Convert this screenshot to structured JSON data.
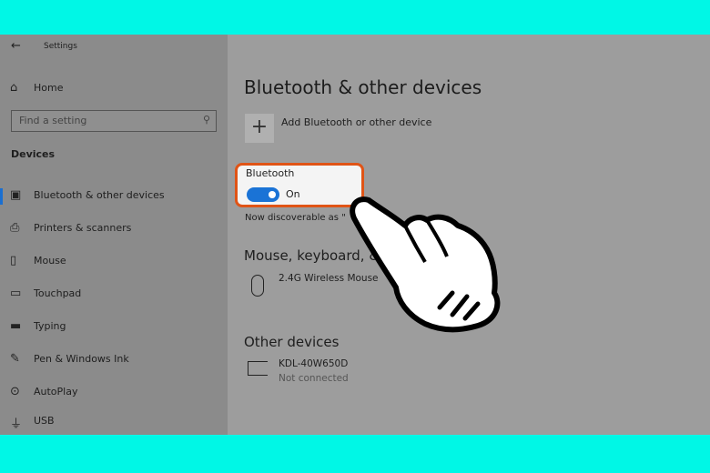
{
  "window": {
    "title": "Settings"
  },
  "sidebar": {
    "home": "Home",
    "search_placeholder": "Find a setting",
    "section": "Devices",
    "items": [
      {
        "label": "Bluetooth & other devices",
        "icon": "bluetooth-devices-icon",
        "selected": true
      },
      {
        "label": "Printers & scanners",
        "icon": "printer-icon"
      },
      {
        "label": "Mouse",
        "icon": "mouse-icon"
      },
      {
        "label": "Touchpad",
        "icon": "touchpad-icon"
      },
      {
        "label": "Typing",
        "icon": "keyboard-icon"
      },
      {
        "label": "Pen & Windows Ink",
        "icon": "pen-icon"
      },
      {
        "label": "AutoPlay",
        "icon": "autoplay-icon"
      },
      {
        "label": "USB",
        "icon": "usb-icon"
      }
    ]
  },
  "main": {
    "title": "Bluetooth & other devices",
    "add_device": "Add Bluetooth or other device",
    "bluetooth": {
      "label": "Bluetooth",
      "state": "On",
      "enabled": true
    },
    "discoverable": "Now discoverable as \"",
    "mouse_section": "Mouse, keyboard, & p",
    "mouse_device": "2.4G Wireless Mouse",
    "other_section": "Other devices",
    "other_device": {
      "name": "KDL-40W650D",
      "status": "Not connected"
    }
  },
  "colors": {
    "highlight": "#e05416",
    "accent": "#1a73d6",
    "frame": "#00f7e6"
  }
}
